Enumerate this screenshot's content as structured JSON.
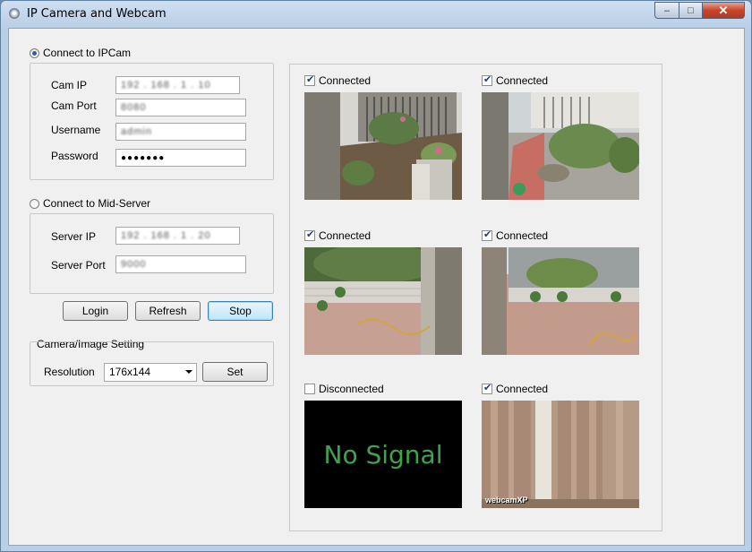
{
  "window": {
    "title": "IP Camera and Webcam",
    "close_glyph": "✕",
    "min_glyph": "–",
    "max_glyph": "□"
  },
  "ipcam": {
    "label": "Connect to IPCam",
    "selected": true,
    "cam_ip_label": "Cam IP",
    "cam_ip_value": "192 . 168 . 1 . 10",
    "cam_port_label": "Cam Port",
    "cam_port_value": "8080",
    "username_label": "Username",
    "username_value": "admin",
    "password_label": "Password",
    "password_value": "●●●●●●●"
  },
  "midserver": {
    "label": "Connect to Mid-Server",
    "selected": false,
    "server_ip_label": "Server IP",
    "server_ip_value": "192 . 168 . 1 . 20",
    "server_port_label": "Server Port",
    "server_port_value": "9000"
  },
  "buttons": {
    "login": "Login",
    "refresh": "Refresh",
    "stop": "Stop"
  },
  "camera_setting": {
    "title": "Camera/Image Setting",
    "resolution_label": "Resolution",
    "resolution_value": "176x144",
    "set_label": "Set"
  },
  "cameras": [
    {
      "status": "Connected",
      "checked": true
    },
    {
      "status": "Connected",
      "checked": true
    },
    {
      "status": "Connected",
      "checked": true
    },
    {
      "status": "Connected",
      "checked": true
    },
    {
      "status": "Disconnected",
      "checked": false,
      "no_signal": "No Signal"
    },
    {
      "status": "Connected",
      "checked": true,
      "watermark": "webcamXP"
    }
  ],
  "colors": {
    "no_signal_text": "#3fa34d",
    "accent": "#3c7fb1"
  }
}
